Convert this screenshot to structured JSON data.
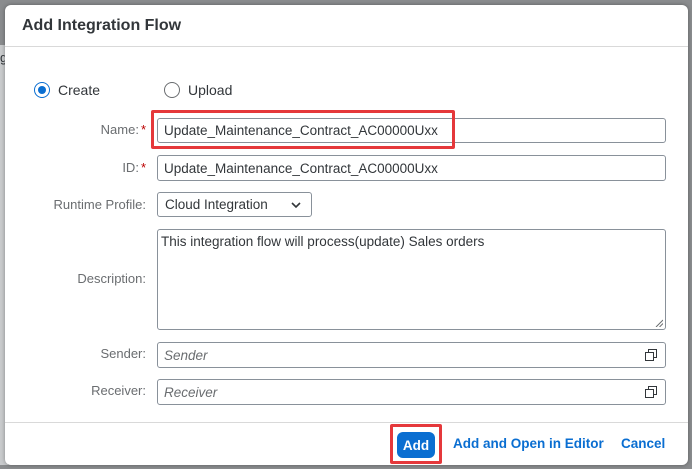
{
  "background": {
    "partial_char": "g"
  },
  "dialog": {
    "title": "Add Integration Flow",
    "mode_options": [
      {
        "label": "Create",
        "selected": true
      },
      {
        "label": "Upload",
        "selected": false
      }
    ],
    "fields": {
      "name": {
        "label": "Name:",
        "required_mark": "*",
        "value": "Update_Maintenance_Contract_AC00000Uxx"
      },
      "id": {
        "label": "ID:",
        "required_mark": "*",
        "value": "Update_Maintenance_Contract_AC00000Uxx"
      },
      "runtime_profile": {
        "label": "Runtime Profile:",
        "value": "Cloud Integration"
      },
      "description": {
        "label": "Description:",
        "value": "This integration flow will process(update) Sales orders"
      },
      "sender": {
        "label": "Sender:",
        "placeholder": "Sender",
        "icon": "value-help-icon"
      },
      "receiver": {
        "label": "Receiver:",
        "placeholder": "Receiver",
        "icon": "value-help-icon"
      }
    },
    "footer": {
      "add_label": "Add",
      "add_open_label": "Add and Open in Editor",
      "cancel_label": "Cancel"
    }
  },
  "colors": {
    "accent": "#0a6ed1",
    "highlight": "#e5383b",
    "required": "#bb0000"
  }
}
